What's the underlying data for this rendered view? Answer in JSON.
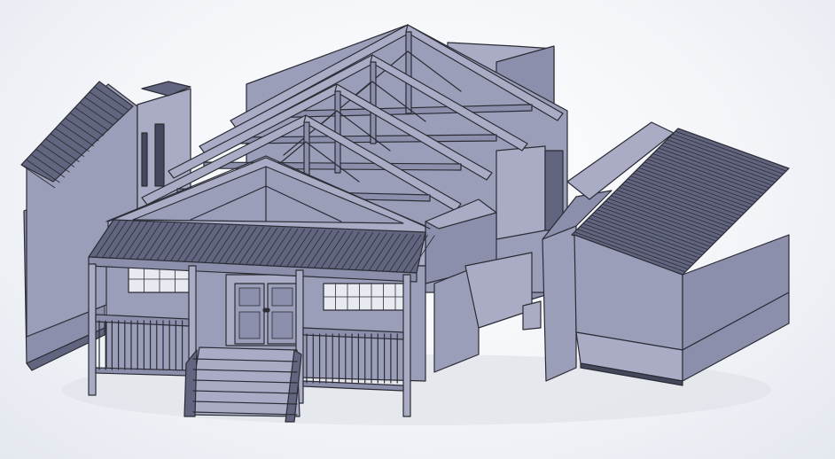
{
  "scene": {
    "kind": "cad-viewport",
    "background_color": "#f1f3f7",
    "model_color": "#9497b1",
    "edge_color": "#2b2c35"
  },
  "components": [
    {
      "name": "left-wall-panel"
    },
    {
      "name": "left-gable-wall"
    },
    {
      "name": "main-house-rafters"
    },
    {
      "name": "front-porch"
    },
    {
      "name": "front-double-doors"
    },
    {
      "name": "porch-steps"
    },
    {
      "name": "side-shed"
    }
  ]
}
